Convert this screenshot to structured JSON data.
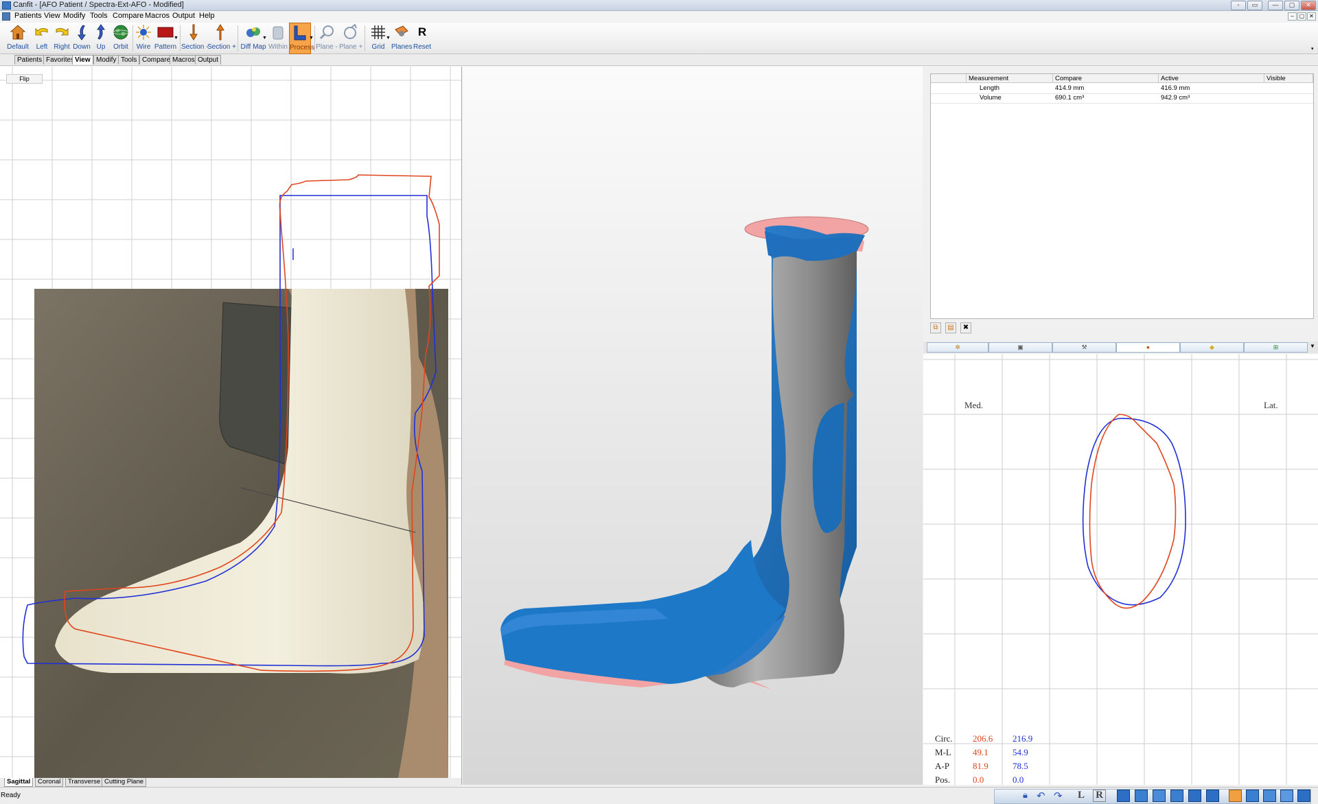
{
  "window": {
    "title": "Canfit - [AFO Patient / Spectra-Ext-AFO - Modified]",
    "buttons": [
      "◦",
      "▭",
      "—",
      "▢",
      "✕"
    ]
  },
  "menu": {
    "items": [
      "Patients",
      "View",
      "Modify",
      "Tools",
      "Compare",
      "Macros",
      "Output",
      "Help"
    ],
    "mdi_buttons": [
      "–",
      "▢",
      "✕"
    ]
  },
  "toolbar": {
    "buttons": [
      {
        "label": "Default",
        "icon": "home-icon"
      },
      {
        "label": "Left",
        "icon": "arrow-left-icon"
      },
      {
        "label": "Right",
        "icon": "arrow-right-icon"
      },
      {
        "label": "Down",
        "icon": "arrow-down-icon"
      },
      {
        "label": "Up",
        "icon": "arrow-up-icon"
      },
      {
        "label": "Orbit",
        "icon": "globe-icon"
      },
      {
        "label": "Wire",
        "icon": "wireframe-icon"
      },
      {
        "label": "Pattern",
        "icon": "pattern-icon"
      },
      {
        "label": "Section -",
        "icon": "section-down-icon"
      },
      {
        "label": "Section +",
        "icon": "section-up-icon"
      },
      {
        "label": "Diff Map",
        "icon": "diff-map-icon"
      },
      {
        "label": "Within",
        "icon": "within-icon"
      },
      {
        "label": "Process",
        "icon": "process-icon"
      },
      {
        "label": "Plane -",
        "icon": "plane-minus-icon"
      },
      {
        "label": "Plane +",
        "icon": "plane-plus-icon"
      },
      {
        "label": "Grid",
        "icon": "grid-icon"
      },
      {
        "label": "Planes",
        "icon": "planes-icon"
      },
      {
        "label": "Reset",
        "icon": "reset-icon",
        "glyph": "R"
      }
    ]
  },
  "tabs": [
    "Patients",
    "Favorites",
    "View",
    "Modify",
    "Tools",
    "Compare",
    "Macros",
    "Output"
  ],
  "active_tab": "View",
  "left_view": {
    "flip_label": "Flip",
    "bottom_tabs": [
      "Sagittal",
      "Coronal",
      "Transverse",
      "Cutting Plane"
    ],
    "active_bottom_tab": "Sagittal"
  },
  "measurements": {
    "headers": [
      "Measurement",
      "Compare",
      "Active",
      "Visible"
    ],
    "rows": [
      {
        "name": "Length",
        "compare": "414.9 mm",
        "active": "416.9 mm",
        "visible": ""
      },
      {
        "name": "Volume",
        "compare": "690.1 cm³",
        "active": "942.9 cm³",
        "visible": ""
      }
    ]
  },
  "cross_section": {
    "med_label": "Med.",
    "lat_label": "Lat.",
    "stats": [
      {
        "label": "Circ.",
        "compare": "206.6",
        "active": "216.9"
      },
      {
        "label": "M-L",
        "compare": "49.1",
        "active": "54.9"
      },
      {
        "label": "A-P",
        "compare": "81.9",
        "active": "78.5"
      },
      {
        "label": "Pos.",
        "compare": "0.0",
        "active": "0.0"
      }
    ]
  },
  "colors": {
    "compare": "#e0451c",
    "active": "#1f2fd6",
    "model_blue": "#1e6fb8",
    "model_gray": "#8a8a8a",
    "model_pink": "#f2a3a3"
  },
  "status": {
    "text": "Ready",
    "buttons": [
      "L",
      "R"
    ]
  }
}
